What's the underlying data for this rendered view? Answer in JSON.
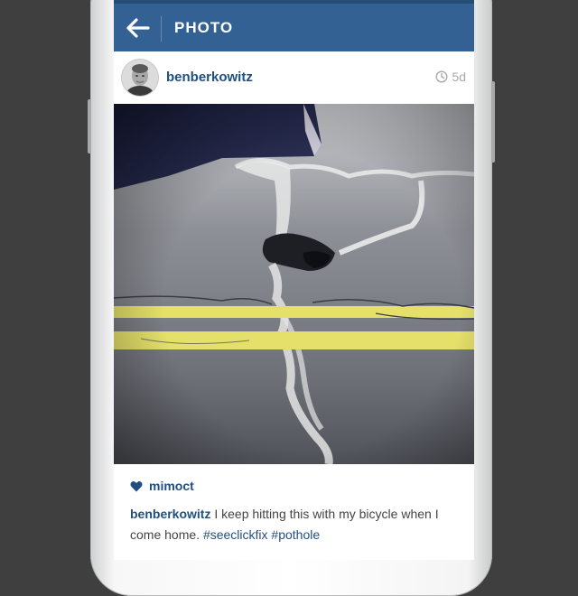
{
  "app_bar": {
    "title": "PHOTO",
    "back_icon": "arrow-left-icon",
    "background": "#336193"
  },
  "post": {
    "username": "benberkowitz",
    "time_icon": "clock-icon",
    "time_ago": "5d",
    "image_alt": "pothole"
  },
  "likes": {
    "icon": "heart-icon",
    "user": "mimoct"
  },
  "caption": {
    "user": "benberkowitz",
    "text": " I keep hitting this with my bicycle when I come home. ",
    "tags": [
      "#seeclickfix",
      "#pothole"
    ]
  },
  "colors": {
    "link": "#1f4f80",
    "muted": "#a9a9a9",
    "frame_bg": "#3f3f3f"
  }
}
